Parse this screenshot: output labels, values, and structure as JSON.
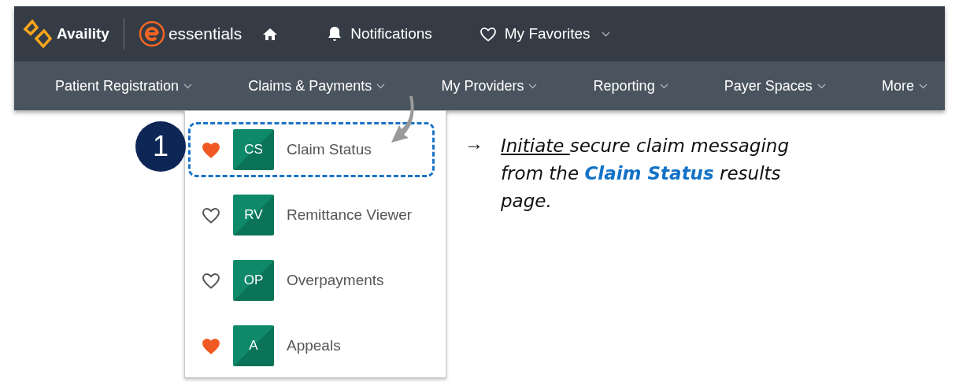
{
  "header": {
    "brand": "Availity",
    "product": "essentials",
    "notifications": "Notifications",
    "favorites": "My Favorites"
  },
  "nav": [
    {
      "label": "Patient Registration"
    },
    {
      "label": "Claims & Payments"
    },
    {
      "label": "My Providers"
    },
    {
      "label": "Reporting"
    },
    {
      "label": "Payer Spaces"
    },
    {
      "label": "More"
    }
  ],
  "menu": [
    {
      "badge": "CS",
      "label": "Claim Status",
      "favorite": true,
      "highlighted": true
    },
    {
      "badge": "RV",
      "label": "Remittance Viewer",
      "favorite": false,
      "highlighted": false
    },
    {
      "badge": "OP",
      "label": "Overpayments",
      "favorite": false,
      "highlighted": false
    },
    {
      "badge": "A",
      "label": "Appeals",
      "favorite": true,
      "highlighted": false
    }
  ],
  "step": "1",
  "note": {
    "arrow": "→",
    "underlined": "Initiate ",
    "text": "secure claim messaging from the **Claim Status** results page."
  }
}
